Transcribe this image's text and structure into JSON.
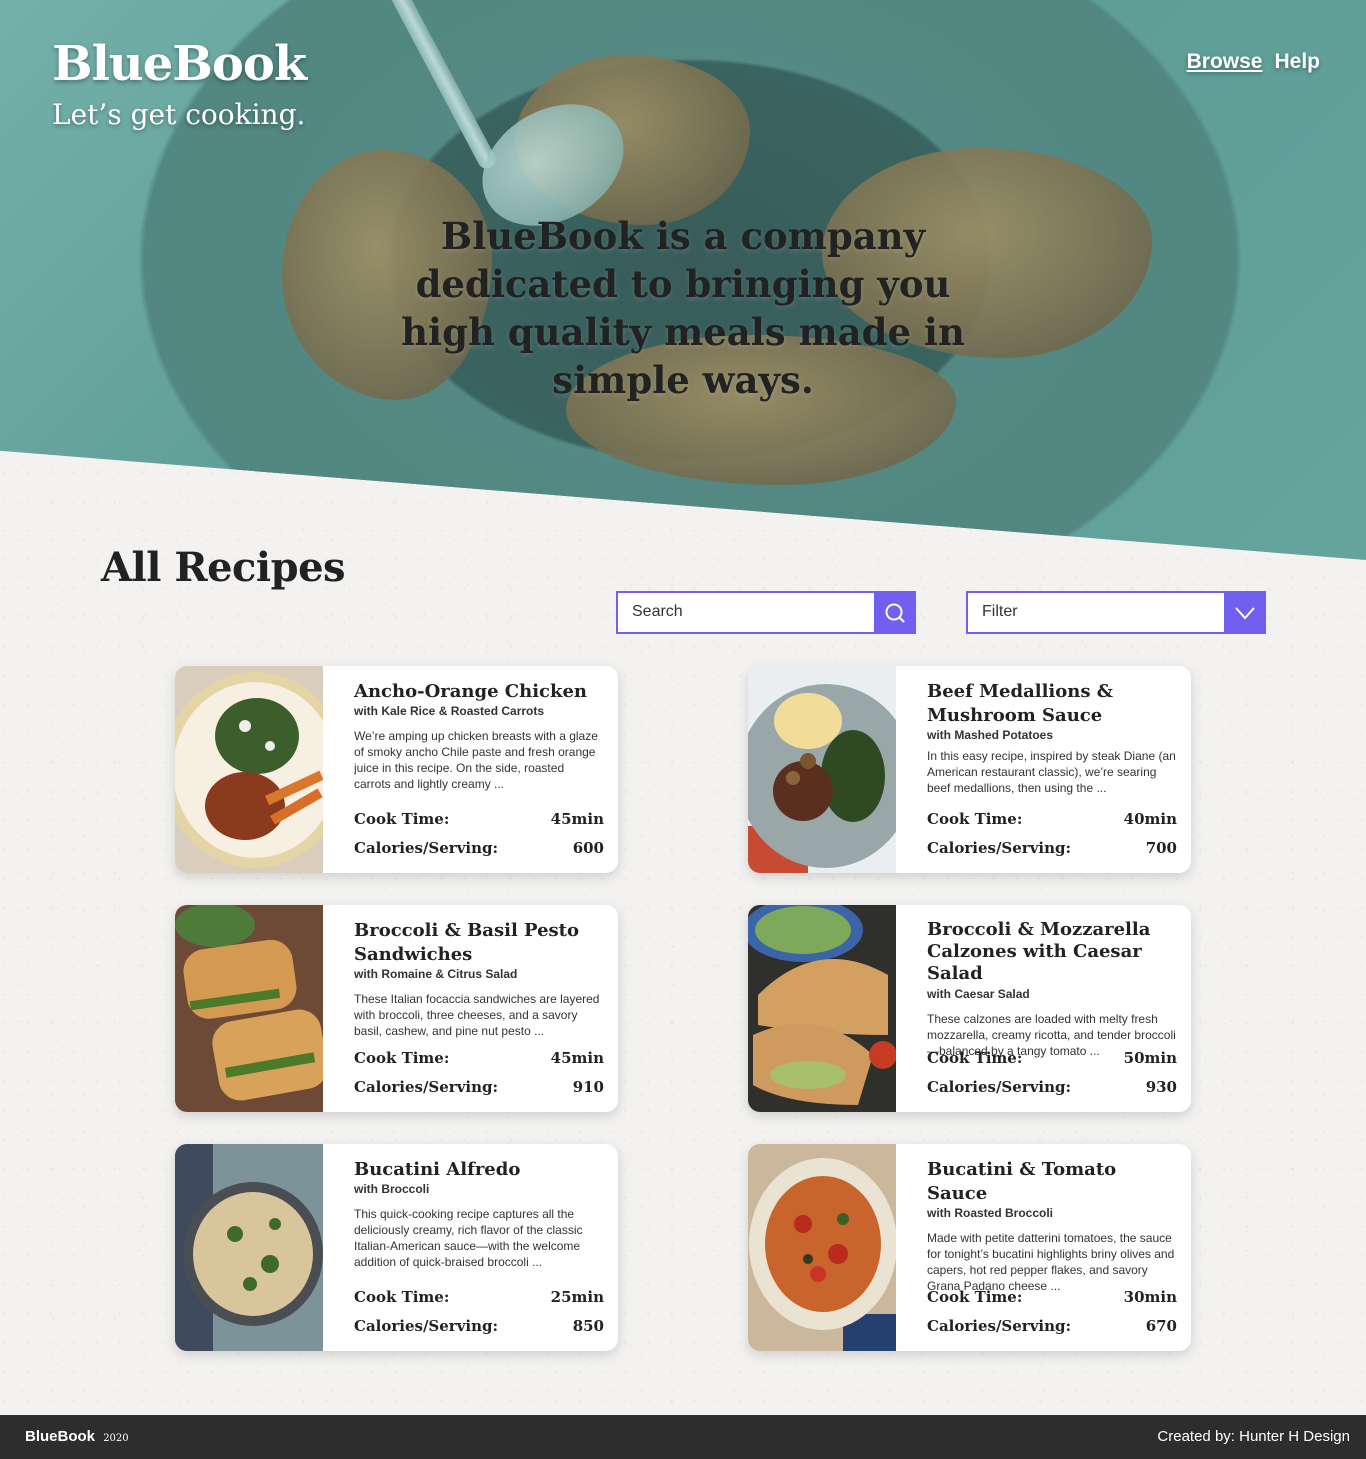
{
  "header": {
    "brand": "BlueBook",
    "tagline": "Let’s get cooking.",
    "nav": [
      {
        "label": "Browse",
        "active": true
      },
      {
        "label": "Help",
        "active": false
      }
    ]
  },
  "hero": {
    "text": "BlueBook is a company dedicated to bringing you high quality meals made in simple ways."
  },
  "main": {
    "title": "All Recipes",
    "search": {
      "placeholder": "Search",
      "icon": "search-icon"
    },
    "filter": {
      "label": "Filter",
      "icon": "chevron-down-icon"
    },
    "accent": "#7160ef",
    "labels": {
      "cook_time": "Cook Time:",
      "calories": "Calories/Serving:"
    },
    "recipes": [
      {
        "title": "Ancho-Orange Chicken",
        "subtitle": "with Kale Rice & Roasted Carrots",
        "description": "We’re amping up chicken breasts with a glaze of smoky ancho Chile paste and fresh orange juice in this recipe. On the side, roasted carrots and lightly creamy ...",
        "cook_time": "45min",
        "calories": "600"
      },
      {
        "title": "Beef Medallions & Mushroom Sauce",
        "subtitle": "with Mashed Potatoes",
        "description": "In this easy recipe, inspired by steak Diane (an American restaurant classic), we’re searing beef medallions, then using the ...",
        "cook_time": "40min",
        "calories": "700"
      },
      {
        "title": "Broccoli & Basil Pesto Sandwiches",
        "subtitle": "with Romaine & Citrus Salad",
        "description": "These Italian focaccia sandwiches are layered with broccoli, three cheeses, and a savory basil, cashew, and pine nut pesto ...",
        "cook_time": "45min",
        "calories": "910"
      },
      {
        "title": "Broccoli & Mozzarella Calzones with Caesar Salad",
        "subtitle": "with Caesar Salad",
        "description": "These calzones are loaded with melty fresh mozzarella, creamy ricotta, and tender broccoli—balanced by a tangy tomato ...",
        "cook_time": "50min",
        "calories": "930"
      },
      {
        "title": "Bucatini Alfredo",
        "subtitle": "with Broccoli",
        "description": "This quick-cooking recipe captures all the deliciously creamy, rich flavor of the classic Italian-American sauce—with the welcome addition of quick-braised broccoli ...",
        "cook_time": "25min",
        "calories": "850"
      },
      {
        "title": "Bucatini & Tomato Sauce",
        "subtitle": "with Roasted Broccoli",
        "description": "Made with petite datterini tomatoes, the sauce for tonight’s bucatini highlights briny olives and capers, hot red pepper flakes, and savory Grana Padano cheese ...",
        "cook_time": "30min",
        "calories": "670"
      }
    ]
  },
  "footer": {
    "brand": "BlueBook",
    "year": "2020",
    "credit": "Created by: Hunter H Design"
  }
}
